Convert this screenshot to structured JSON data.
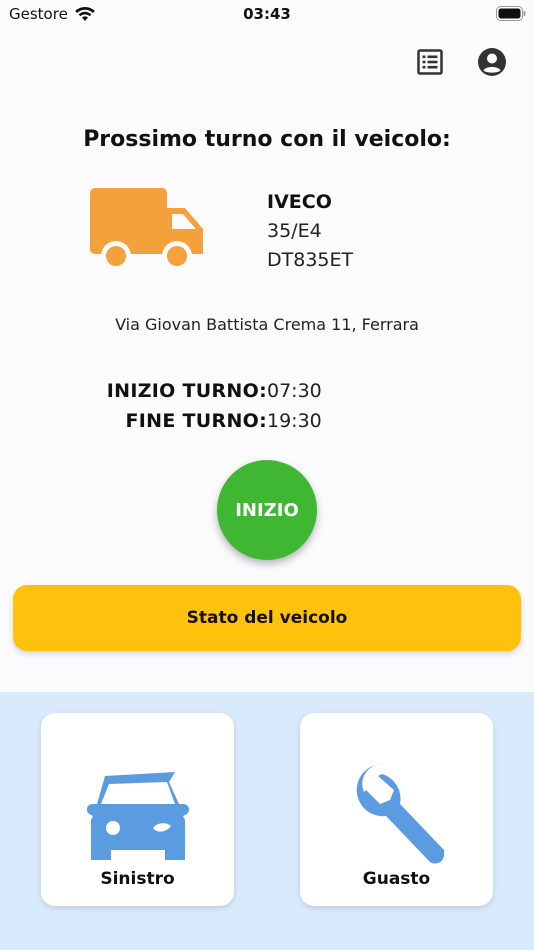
{
  "status_bar": {
    "carrier": "Gestore",
    "time": "03:43"
  },
  "header": {
    "list_icon": "list-icon",
    "profile_icon": "account-circle-icon"
  },
  "main": {
    "heading": "Prossimo turno con il veicolo:",
    "vehicle_icon": "truck-icon",
    "vehicle": {
      "brand": "IVECO",
      "model": "35/E4",
      "plate": "DT835ET"
    },
    "address": "Via Giovan Battista Crema 11, Ferrara",
    "shift": {
      "start_label": "INIZIO TURNO:",
      "start_value": "07:30",
      "end_label": "FINE TURNO:",
      "end_value": "19:30"
    },
    "start_button": "INIZIO",
    "vehicle_state_button": "Stato del veicolo"
  },
  "actions": [
    {
      "label": "Sinistro",
      "icon": "car-crash-icon"
    },
    {
      "label": "Guasto",
      "icon": "wrench-icon"
    }
  ],
  "colors": {
    "truck": "#f4a03d",
    "start_button": "#3fb733",
    "state_button": "#ffc20c",
    "panel_bg": "#d8eafb",
    "action_icon": "#5b9be0"
  }
}
